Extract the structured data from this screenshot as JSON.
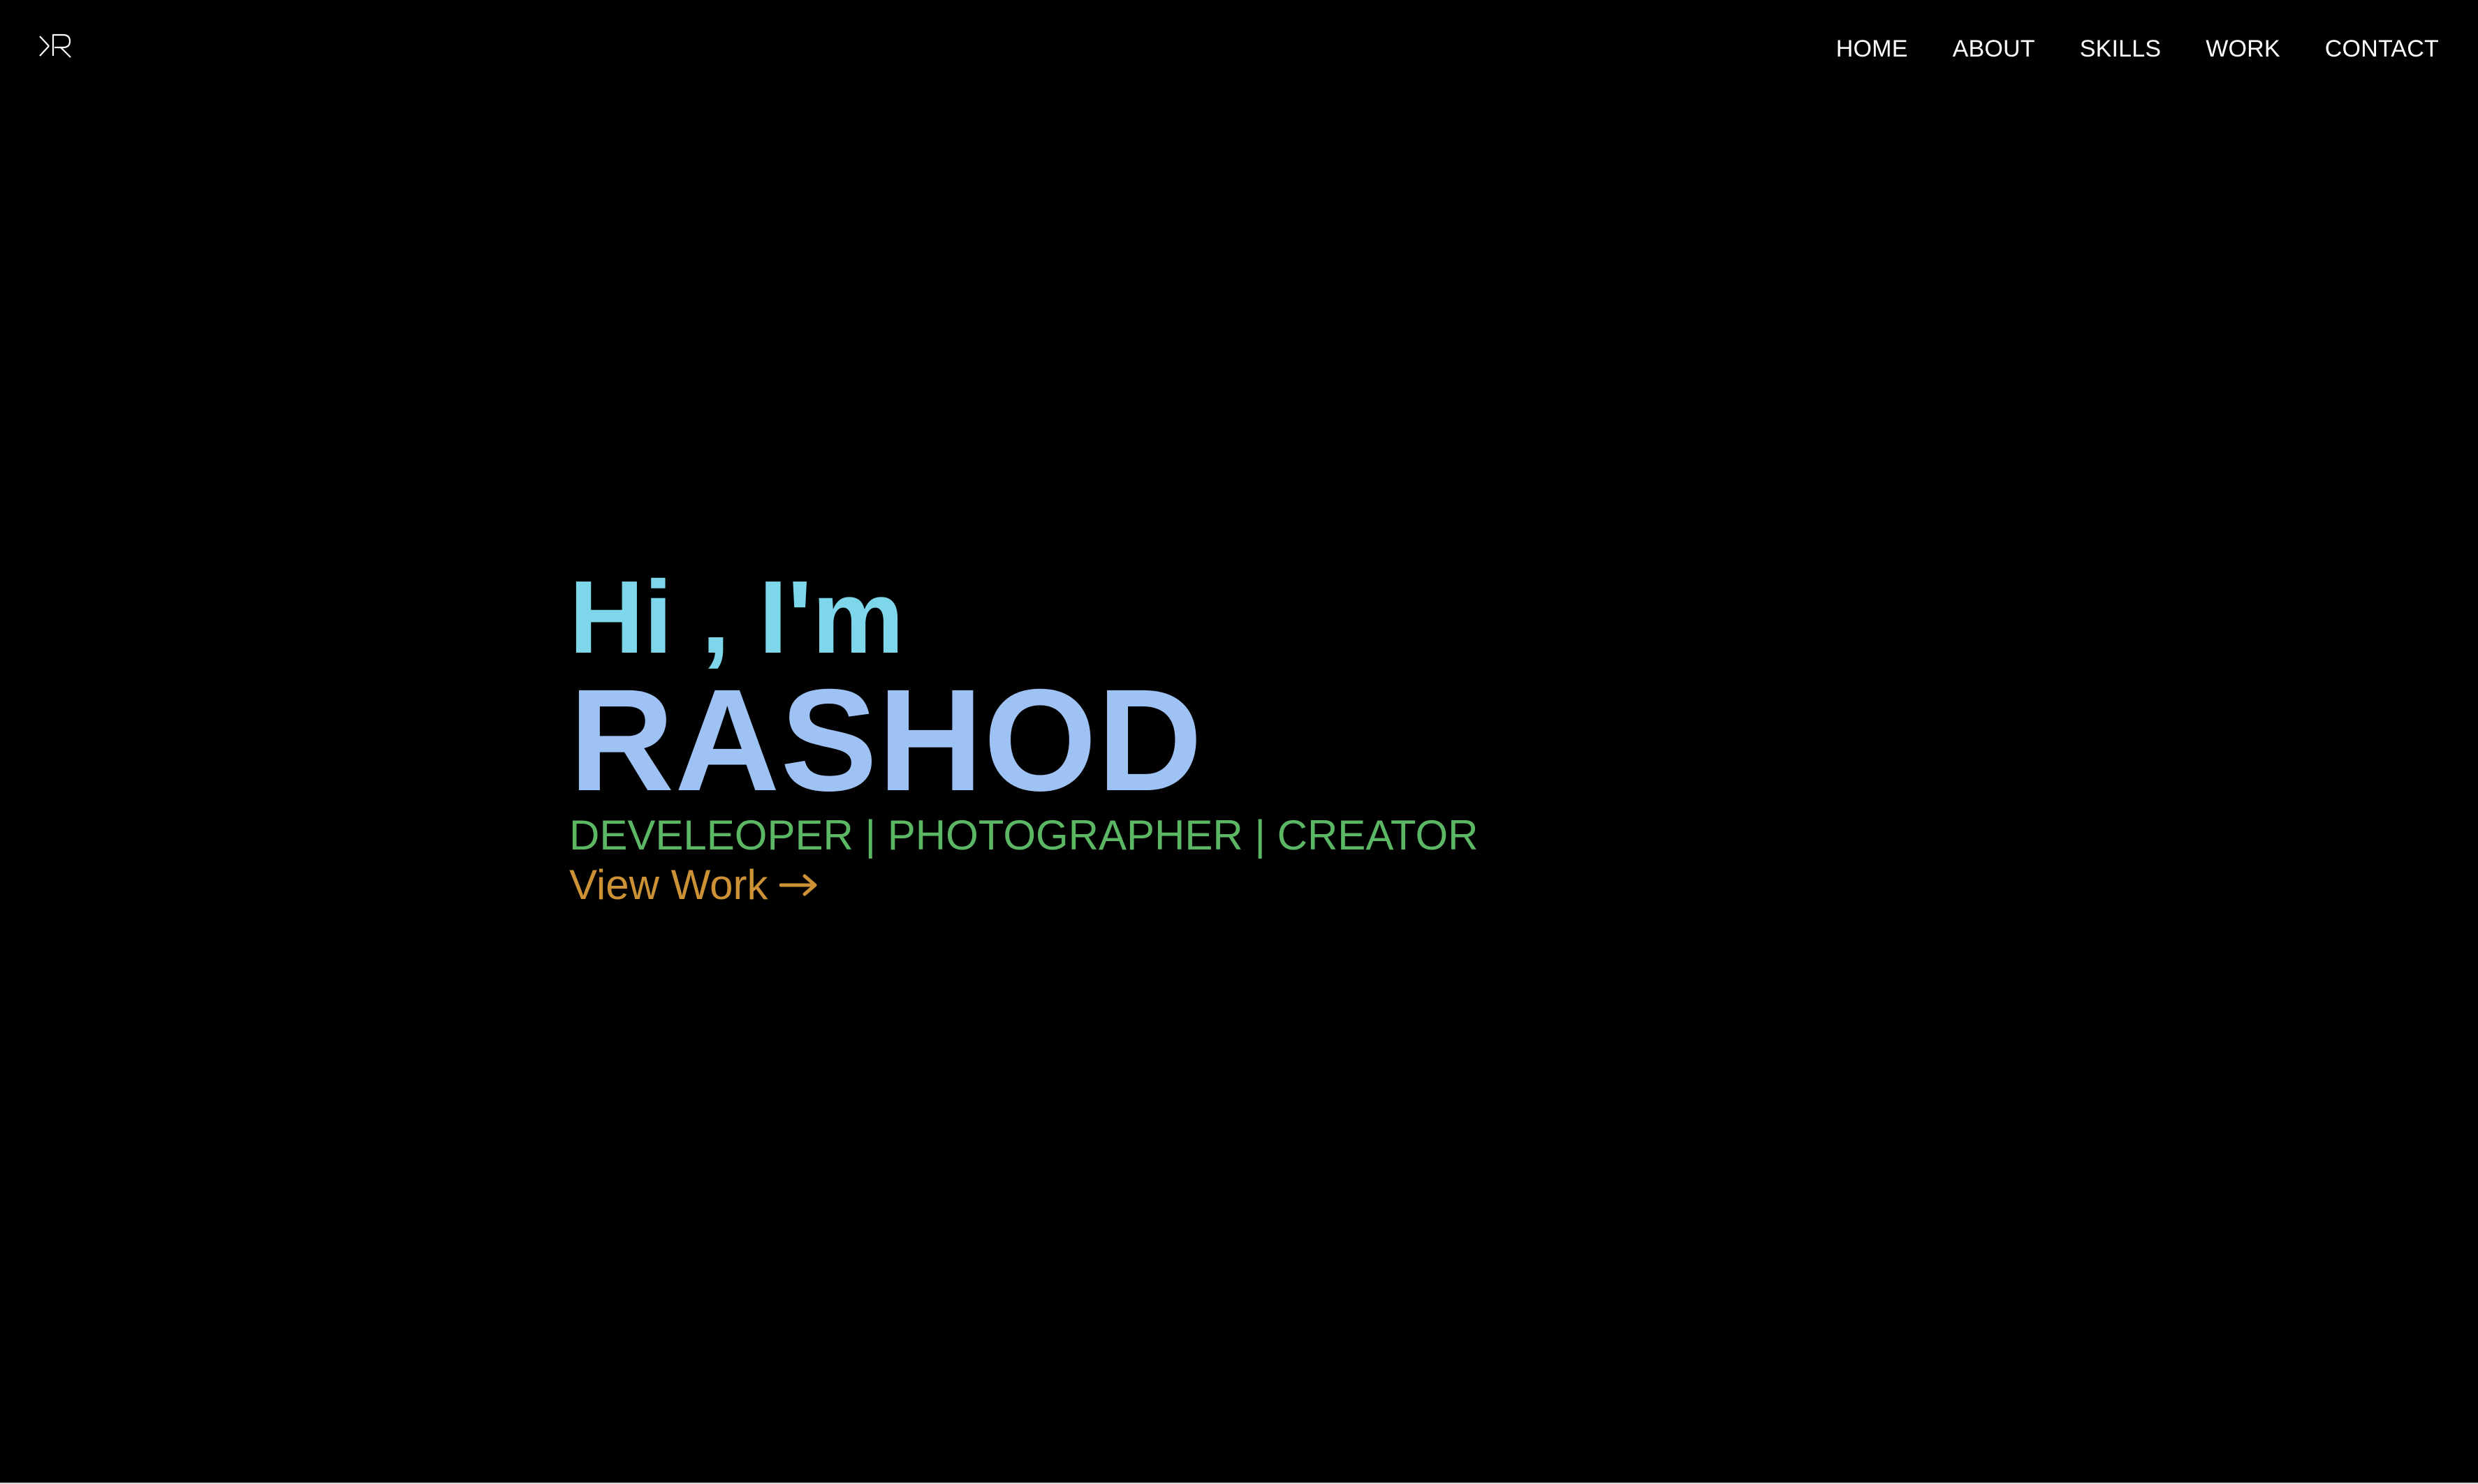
{
  "logo": {
    "text": "KR",
    "color": "#ffffff"
  },
  "nav": {
    "items": [
      {
        "label": "HOME"
      },
      {
        "label": "ABOUT"
      },
      {
        "label": "SKILLS"
      },
      {
        "label": "WORK"
      },
      {
        "label": "CONTACT"
      }
    ]
  },
  "hero": {
    "greeting": "Hi , I'm",
    "name": "RASHOD",
    "roles": "DEVELEOPER | PHOTOGRAPHER | CREATOR",
    "cta_label": "View Work",
    "cta_icon": "arrow-right-icon"
  },
  "colors": {
    "background": "#000000",
    "greeting": "#7ed6ea",
    "name": "#9ec2f4",
    "roles": "#5cb765",
    "cta": "#cc9235",
    "nav": "#ffffff"
  }
}
